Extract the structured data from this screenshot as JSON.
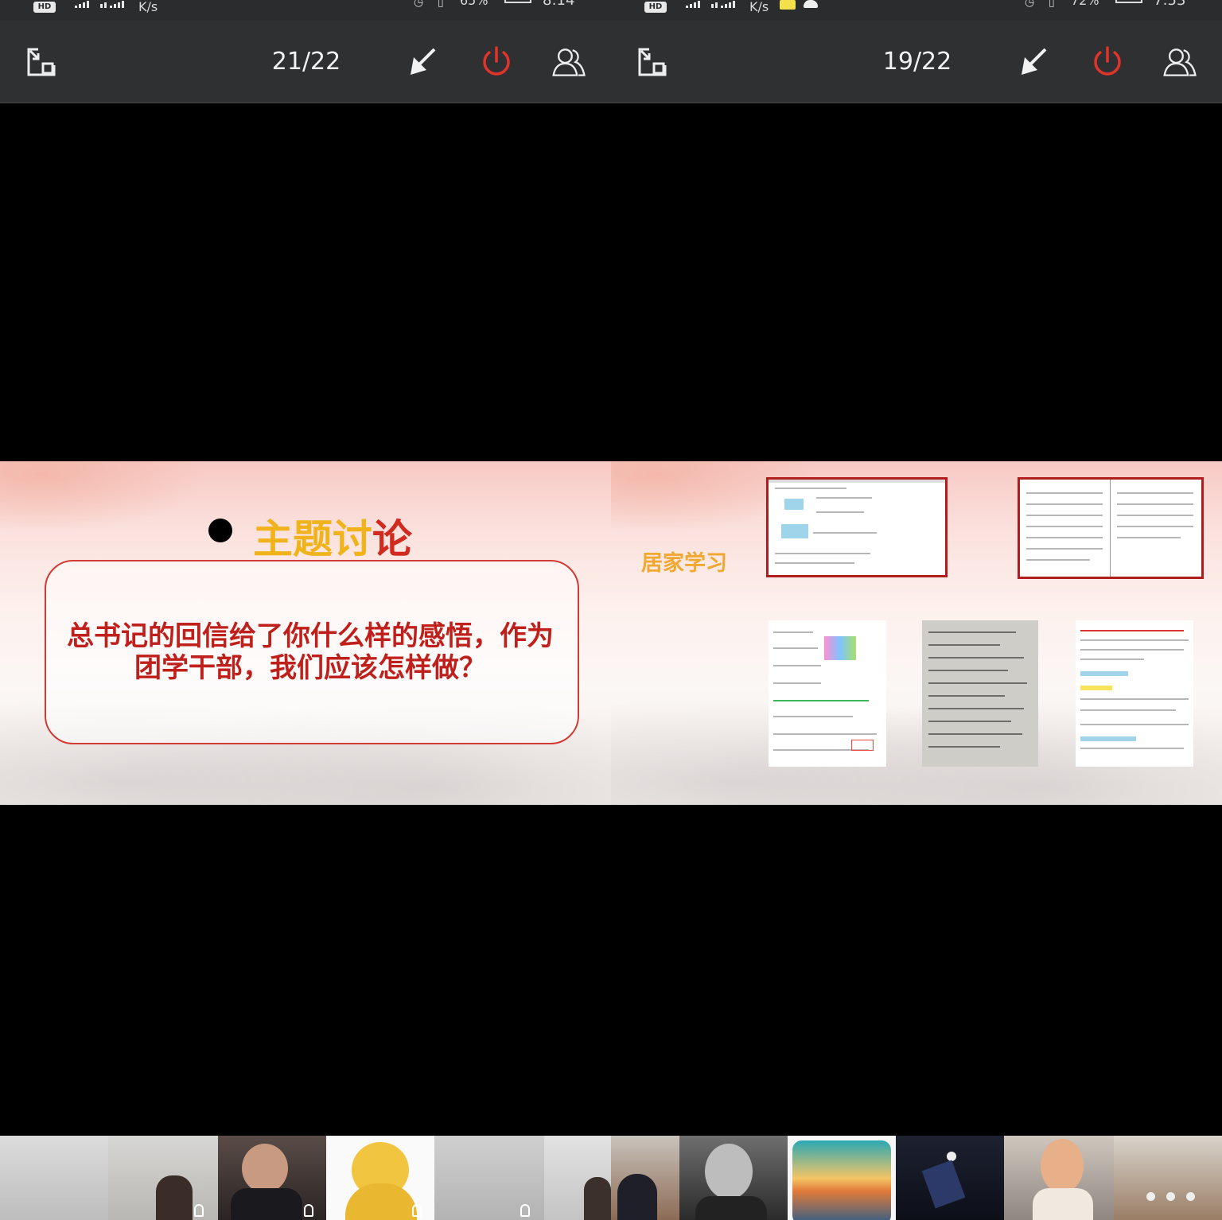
{
  "left": {
    "status": {
      "hd": "HD",
      "net_speed": "K/s",
      "battery_pct": "65%",
      "time": "8:14"
    },
    "toolbar": {
      "page_counter": "21/22"
    },
    "slide": {
      "title_part1": "主题讨",
      "title_part2": "论",
      "question_line1": "总书记的回信给了你什么样的感悟，作为",
      "question_line2": "团学干部，我们应该怎样做？"
    },
    "participants": [
      "participant-1",
      "participant-2",
      "participant-3",
      "participant-4",
      "participant-5",
      "participant-6"
    ]
  },
  "right": {
    "status": {
      "hd": "HD",
      "net_speed": "K/s",
      "battery_pct": "72%",
      "time": "7:53"
    },
    "toolbar": {
      "page_counter": "19/22"
    },
    "slide": {
      "label": "居家学习",
      "thumbnails": [
        "document-screenshot",
        "two-page-document",
        "worksheet-scan",
        "handwritten-notes",
        "annotated-worksheet"
      ]
    },
    "participants": [
      "participant-1",
      "participant-2",
      "participant-3",
      "participant-4",
      "participant-5",
      "participant-6"
    ]
  },
  "colors": {
    "toolbar_bg": "#2f3032",
    "power_red": "#e0332b",
    "title_gold": "#f1b31c",
    "title_red": "#d12a1f",
    "question_red": "#c0201c",
    "frame_red": "#b11d1d"
  },
  "icons": [
    "exit-fullscreen-icon",
    "laser-pointer-arrow-icon",
    "power-icon",
    "participants-icon",
    "mic-icon",
    "more-dots-icon"
  ]
}
